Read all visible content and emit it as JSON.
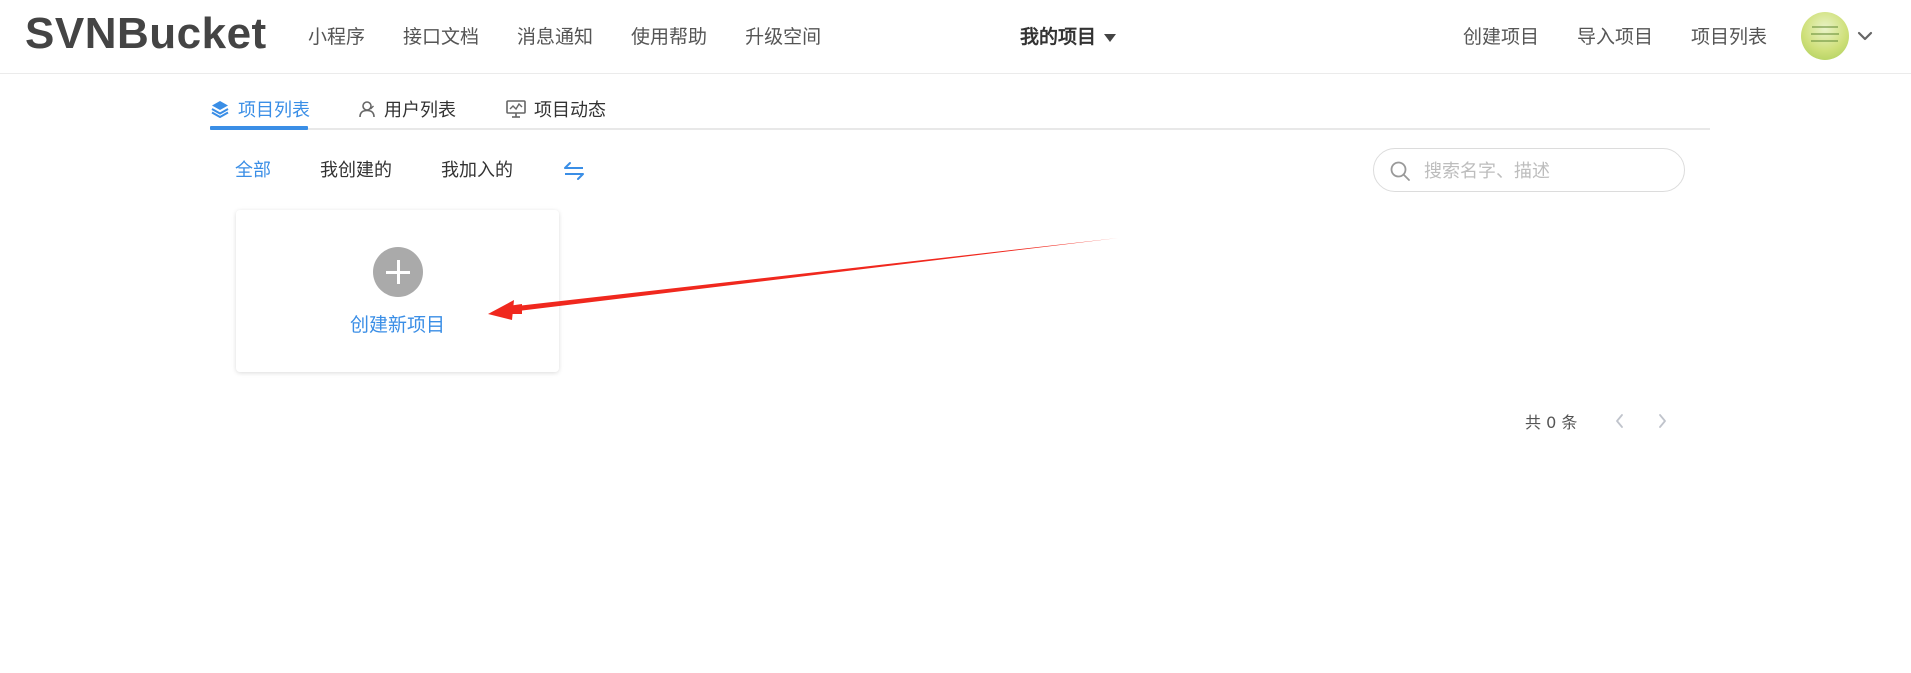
{
  "header": {
    "logo": "SVNBucket",
    "nav_left": [
      "小程序",
      "接口文档",
      "消息通知",
      "使用帮助",
      "升级空间"
    ],
    "center_menu": "我的项目",
    "nav_right": [
      "创建项目",
      "导入项目",
      "项目列表"
    ]
  },
  "tabs": {
    "items": [
      {
        "label": "项目列表",
        "icon": "layers-icon",
        "active": true
      },
      {
        "label": "用户列表",
        "icon": "user-icon",
        "active": false
      },
      {
        "label": "项目动态",
        "icon": "activity-icon",
        "active": false
      }
    ]
  },
  "filters": {
    "items": [
      "全部",
      "我创建的",
      "我加入的"
    ],
    "active_index": 0,
    "toggle_icon": "swap-arrows-icon"
  },
  "search": {
    "placeholder": "搜索名字、描述",
    "value": ""
  },
  "create_card": {
    "icon": "plus-circle-icon",
    "label": "创建新项目"
  },
  "pagination": {
    "total_text": "共 0 条"
  },
  "colors": {
    "accent": "#3a8ee6",
    "annotation_arrow": "#f0281e",
    "plus_circle": "#aaaaaa"
  }
}
